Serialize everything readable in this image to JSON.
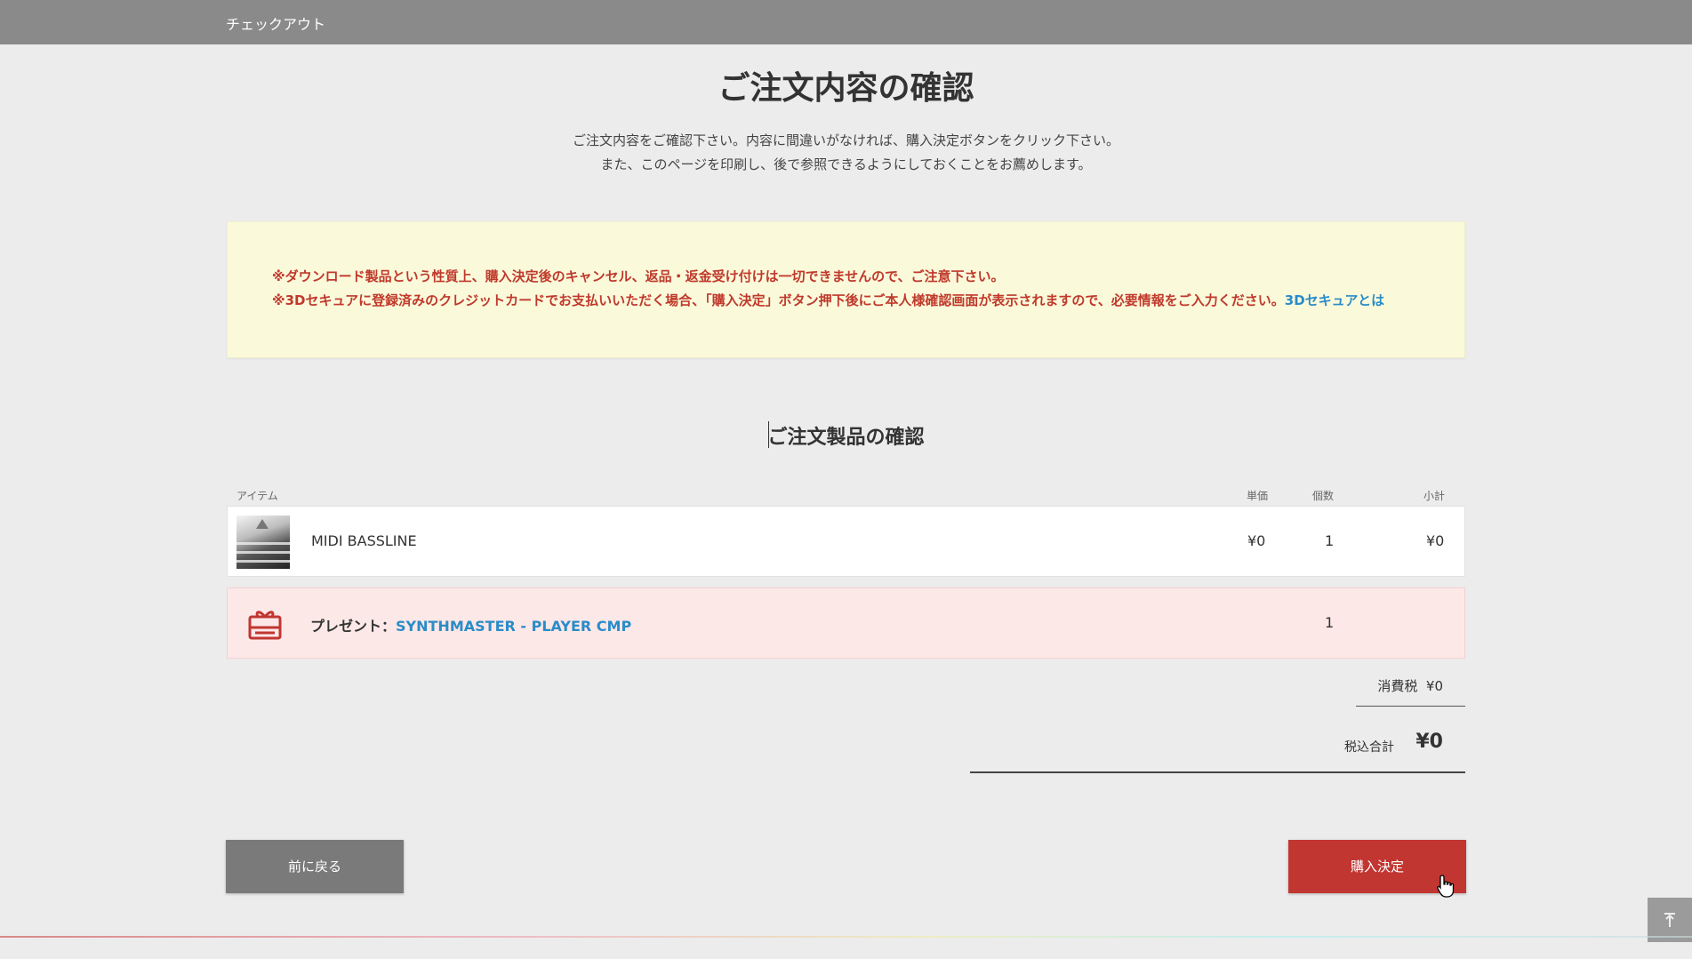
{
  "header": {
    "title": "チェックアウト"
  },
  "page": {
    "title": "ご注文内容の確認",
    "intro_lines": [
      "ご注文内容をご確認下さい。内容に間違いがなければ、購入決定ボタンをクリック下さい。",
      "また、このページを印刷し、後で参照できるようにしておくことをお薦めします。"
    ]
  },
  "notice": {
    "line1": "※ダウンロード製品という性質上、購入決定後のキャンセル、返品・返金受け付けは一切できませんので、ご注意下さい。",
    "line2": "※3Dセキュアに登録済みのクレジットカードでお支払いいただく場合、「購入決定」ボタン押下後にご本人様確認画面が表示されますので、必要情報をご入力ください。",
    "link": "3Dセキュアとは"
  },
  "order": {
    "section_title": "ご注文製品の確認",
    "columns": {
      "item": "アイテム",
      "unit_price": "単価",
      "quantity": "個数",
      "subtotal": "小計"
    },
    "items": [
      {
        "name": "MIDI BASSLINE",
        "unit_price": "¥0",
        "quantity": "1",
        "subtotal": "¥0"
      }
    ],
    "gift": {
      "label": "プレゼント：",
      "name": "SYNTHMASTER - PLAYER CMP",
      "quantity": "1"
    },
    "tax": {
      "label": "消費税",
      "value": "¥0"
    },
    "total": {
      "label": "税込合計",
      "value": "¥0"
    }
  },
  "actions": {
    "back": "前に戻る",
    "buy": "購入決定"
  },
  "colors": {
    "header_bg": "#8a8a8a",
    "buy_button": "#c13631",
    "notice_text": "#c0392b",
    "link": "#2a8cc8",
    "gift_bg": "#fde8e8"
  }
}
